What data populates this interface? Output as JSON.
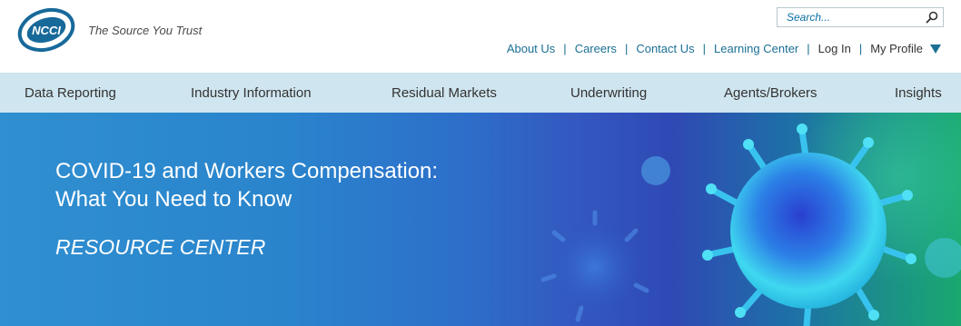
{
  "header": {
    "tagline": "The Source You Trust",
    "logo_alt": "NCCI",
    "search": {
      "placeholder": "Search..."
    },
    "utility_links": [
      "About Us",
      "Careers",
      "Contact Us",
      "Learning Center",
      "Log In",
      "My Profile"
    ]
  },
  "nav": {
    "items": [
      "Data Reporting",
      "Industry Information",
      "Residual Markets",
      "Underwriting",
      "Agents/Brokers",
      "Insights"
    ]
  },
  "hero": {
    "title_line1": "COVID-19 and Workers Compensation:",
    "title_line2": "What You Need to Know",
    "subtitle": "RESOURCE CENTER"
  },
  "colors": {
    "accent": "#1a6f94",
    "nav_bg": "#cfe5ef",
    "hero_start": "#2f8fd0",
    "hero_end": "#19a96f"
  },
  "icons": {
    "search_button": "search-icon",
    "profile_dropdown": "caret-down-icon"
  }
}
